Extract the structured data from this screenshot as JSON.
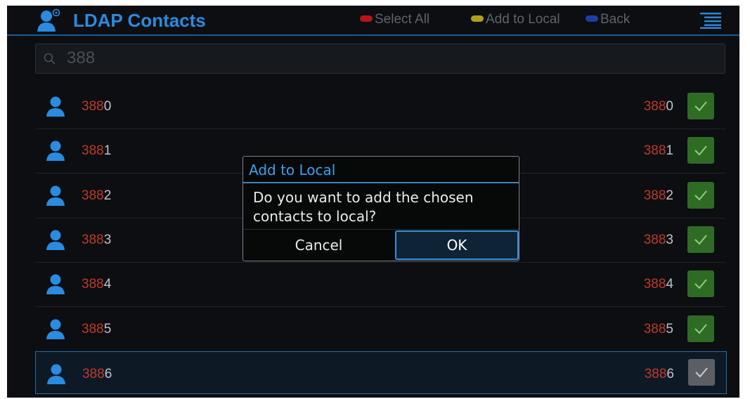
{
  "header": {
    "title": "LDAP Contacts",
    "softkeys": [
      {
        "label": "Select All",
        "color": "#b8151b"
      },
      {
        "label": "Add to Local",
        "color": "#b0a11a"
      },
      {
        "label": "Back",
        "color": "#1b3fa6"
      }
    ],
    "icons": {
      "title": "contacts-icon",
      "menu": "menu-icon"
    }
  },
  "search": {
    "value": "388",
    "icon": "search-icon"
  },
  "contacts": [
    {
      "name_match": "388",
      "name_rest": "0",
      "number_match": "388",
      "number_rest": "0",
      "checked": true
    },
    {
      "name_match": "388",
      "name_rest": "1",
      "number_match": "388",
      "number_rest": "1",
      "checked": true
    },
    {
      "name_match": "388",
      "name_rest": "2",
      "number_match": "388",
      "number_rest": "2",
      "checked": true
    },
    {
      "name_match": "388",
      "name_rest": "3",
      "number_match": "388",
      "number_rest": "3",
      "checked": true
    },
    {
      "name_match": "388",
      "name_rest": "4",
      "number_match": "388",
      "number_rest": "4",
      "checked": true
    },
    {
      "name_match": "388",
      "name_rest": "5",
      "number_match": "388",
      "number_rest": "5",
      "checked": true
    },
    {
      "name_match": "388",
      "name_rest": "6",
      "number_match": "388",
      "number_rest": "6",
      "checked": true
    }
  ],
  "dialog": {
    "title": "Add to Local",
    "message_line1": "Do you want to add the chosen",
    "message_line2": "contacts to local?",
    "cancel_label": "Cancel",
    "ok_label": "OK"
  },
  "colors": {
    "accent": "#2a8be0",
    "match_highlight": "#c0392b",
    "check_on": "#2f6b25",
    "check_focused": "#5b5f63"
  }
}
